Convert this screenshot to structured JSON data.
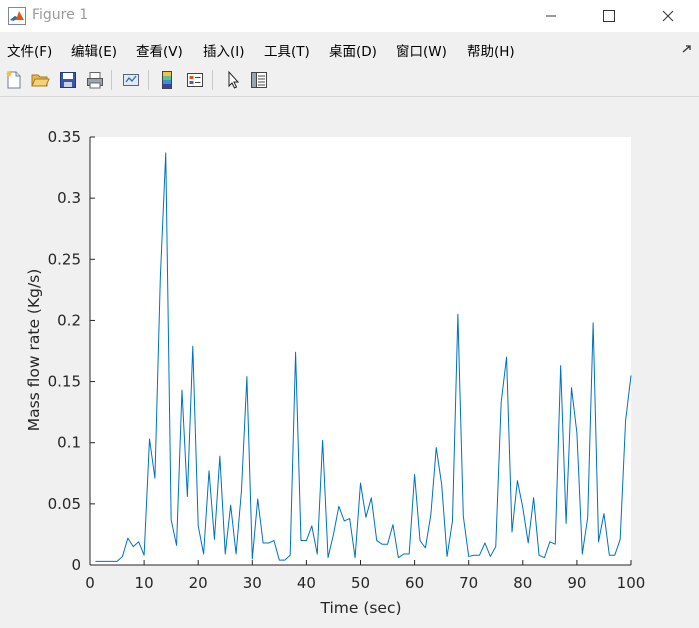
{
  "window": {
    "title": "Figure 1",
    "accent": "#0072bd"
  },
  "menu": {
    "items": [
      {
        "label": "文件(F)"
      },
      {
        "label": "编辑(E)"
      },
      {
        "label": "查看(V)"
      },
      {
        "label": "插入(I)"
      },
      {
        "label": "工具(T)"
      },
      {
        "label": "桌面(D)"
      },
      {
        "label": "窗口(W)"
      },
      {
        "label": "帮助(H)"
      }
    ]
  },
  "toolbar": {
    "icons": [
      "new-figure-icon",
      "open-file-icon",
      "save-icon",
      "print-icon",
      "link-plot-icon",
      "insert-colorbar-icon",
      "insert-legend-icon",
      "pointer-icon",
      "property-inspector-icon"
    ]
  },
  "chart_data": {
    "type": "line",
    "title": "",
    "xlabel": "Time (sec)",
    "ylabel": "Mass flow rate (Kg/s)",
    "xlim": [
      0,
      100
    ],
    "ylim": [
      0,
      0.35
    ],
    "xticks": [
      "0",
      "10",
      "20",
      "30",
      "40",
      "50",
      "60",
      "70",
      "80",
      "90",
      "100"
    ],
    "yticks": [
      "0",
      "0.05",
      "0.1",
      "0.15",
      "0.2",
      "0.25",
      "0.3",
      "0.35"
    ],
    "grid": false,
    "line_color": "#0072bd",
    "series": [
      {
        "x": [
          1,
          2,
          3,
          4,
          5,
          6,
          7,
          8,
          9,
          10,
          11,
          12,
          13,
          14,
          15,
          16,
          17,
          18,
          19,
          20,
          21,
          22,
          23,
          24,
          25,
          26,
          27,
          28,
          29,
          30,
          31,
          32,
          33,
          34,
          35,
          36,
          37,
          38,
          39,
          40,
          41,
          42,
          43,
          44,
          45,
          46,
          47,
          48,
          49,
          50,
          51,
          52,
          53,
          54,
          55,
          56,
          57,
          58,
          59,
          60,
          61,
          62,
          63,
          64,
          65,
          66,
          67,
          68,
          69,
          70,
          71,
          72,
          73,
          74,
          75,
          76,
          77,
          78,
          79,
          80,
          81,
          82,
          83,
          84,
          85,
          86,
          87,
          88,
          89,
          90,
          91,
          92,
          93,
          94,
          95,
          96,
          97,
          98,
          99,
          100
        ],
        "y": [
          0.003,
          0.003,
          0.003,
          0.003,
          0.003,
          0.007,
          0.022,
          0.015,
          0.019,
          0.008,
          0.103,
          0.071,
          0.235,
          0.337,
          0.037,
          0.016,
          0.143,
          0.056,
          0.179,
          0.032,
          0.009,
          0.077,
          0.021,
          0.089,
          0.009,
          0.049,
          0.009,
          0.061,
          0.154,
          0.005,
          0.054,
          0.018,
          0.018,
          0.02,
          0.004,
          0.004,
          0.008,
          0.174,
          0.02,
          0.02,
          0.032,
          0.009,
          0.102,
          0.006,
          0.025,
          0.048,
          0.036,
          0.038,
          0.006,
          0.067,
          0.039,
          0.055,
          0.02,
          0.017,
          0.017,
          0.033,
          0.006,
          0.009,
          0.009,
          0.074,
          0.02,
          0.014,
          0.041,
          0.096,
          0.066,
          0.007,
          0.036,
          0.205,
          0.04,
          0.007,
          0.008,
          0.008,
          0.018,
          0.007,
          0.015,
          0.133,
          0.17,
          0.027,
          0.069,
          0.047,
          0.018,
          0.055,
          0.008,
          0.006,
          0.019,
          0.017,
          0.163,
          0.034,
          0.145,
          0.108,
          0.009,
          0.039,
          0.198,
          0.019,
          0.042,
          0.008,
          0.008,
          0.021,
          0.118,
          0.155
        ]
      }
    ]
  }
}
